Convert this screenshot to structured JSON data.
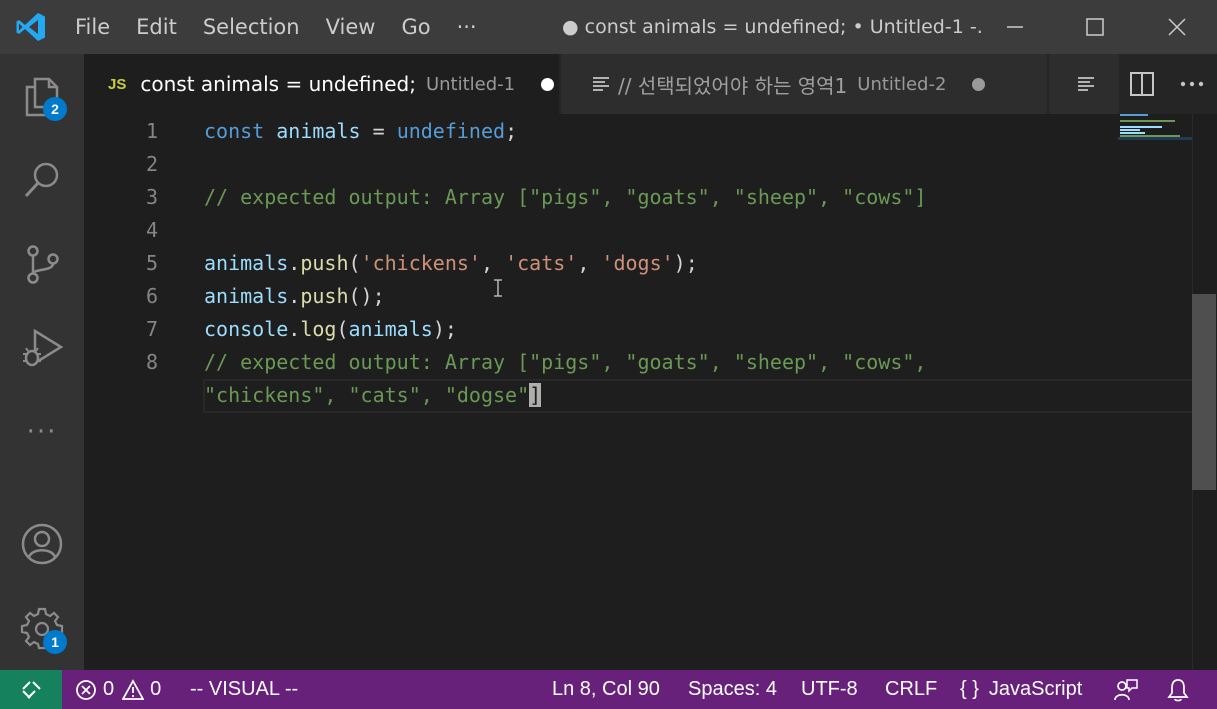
{
  "menu": {
    "file": "File",
    "edit": "Edit",
    "selection": "Selection",
    "view": "View",
    "go": "Go",
    "more": "···"
  },
  "window": {
    "title": "● const animals = undefined; • Untitled-1 -..."
  },
  "activity": {
    "explorer_badge": "2",
    "settings_badge": "1",
    "more": "···"
  },
  "tabs": [
    {
      "icon": "JS",
      "name": "const animals = undefined;",
      "desc": "Untitled-1"
    },
    {
      "name": "// 선택되었어야 하는 영역1",
      "desc": "Untitled-2"
    }
  ],
  "editor": {
    "line_numbers": [
      "1",
      "2",
      "3",
      "4",
      "5",
      "6",
      "7",
      "8"
    ],
    "lines": {
      "l1": {
        "kw": "const",
        "var": "animals",
        "eq": " = ",
        "kw2": "undefined",
        "end": ";"
      },
      "l3": {
        "comment": "// expected output: Array [\"pigs\", \"goats\", \"sheep\", \"cows\"]"
      },
      "l5": {
        "var": "animals",
        "dot": ".",
        "fn": "push",
        "open": "(",
        "s1": "'chickens'",
        "c1": ", ",
        "s2": "'cats'",
        "c2": ", ",
        "s3": "'dogs'",
        "close": ");"
      },
      "l6": {
        "var": "animals",
        "dot": ".",
        "fn": "push",
        "rest": "();"
      },
      "l7": {
        "var": "console",
        "dot": ".",
        "fn": "log",
        "open": "(",
        "arg": "animals",
        "close": ");"
      },
      "l8a": {
        "comment": "// expected output: Array [\"pigs\", \"goats\", \"sheep\", \"cows\","
      },
      "l8b": {
        "comment": "\"chickens\", \"cats\", \"dogse\"",
        "cursor": "]"
      }
    }
  },
  "status": {
    "errors": "0",
    "warnings": "0",
    "mode": "-- VISUAL --",
    "position": "Ln 8, Col 90",
    "spaces": "Spaces: 4",
    "encoding": "UTF-8",
    "eol": "CRLF",
    "language_icon": "{ }",
    "language": "JavaScript"
  },
  "colors": {
    "statusbar": "#68217a",
    "remote": "#16825d",
    "accent": "#007acc"
  }
}
